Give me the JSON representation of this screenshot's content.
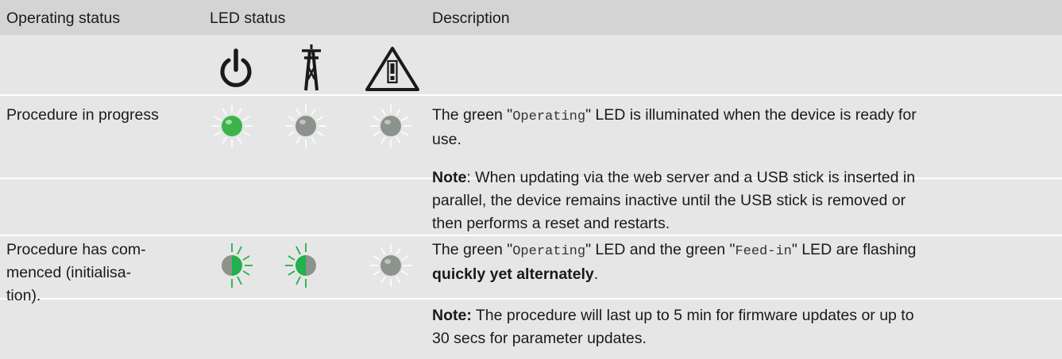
{
  "header": {
    "col1": "Operating status",
    "col2": "LED status",
    "col3": "Description"
  },
  "icons": {
    "led1": "power-icon",
    "led2": "pylon-icon",
    "led3": "warning-icon"
  },
  "rows": [
    {
      "status": "Procedure in progress",
      "leds": [
        "green-lit-glow",
        "grey-glow",
        "grey-glow"
      ],
      "desc_pre": "The green \"",
      "desc_mono1": "Operating",
      "desc_mid": "\" LED is illuminated when the device is ready for",
      "desc_line2": "use.",
      "note_label": "Note",
      "note_line1": ": When updating via the web server and a USB stick is inserted in",
      "note_line2": "parallel, the device remains inactive until the USB stick is removed or",
      "note_line3": "then performs a reset and restarts."
    },
    {
      "status_line1": "Procedure has com-",
      "status_line2": "menced (initialisa-",
      "status_line3": "tion).",
      "leds": [
        "half-green-left-flash",
        "half-green-right-flash",
        "grey-glow"
      ],
      "desc_pre": "The green \"",
      "desc_mono1": "Operating",
      "desc_mid": "\" LED and the green \"",
      "desc_mono2": "Feed-in",
      "desc_post": "\" LED are flashing",
      "desc_bold": "quickly yet alternately",
      "desc_end": ".",
      "note_label": "Note:",
      "note_line1": " The procedure will last up to 5 min for firmware updates or up to",
      "note_line2": "30 secs for parameter updates."
    }
  ],
  "colors": {
    "header_bg": "#d4d4d4",
    "row_bg": "#e6e6e6",
    "led_green": "#3bb54a",
    "led_grey": "#8c928c",
    "flash_green": "#22b14c"
  }
}
